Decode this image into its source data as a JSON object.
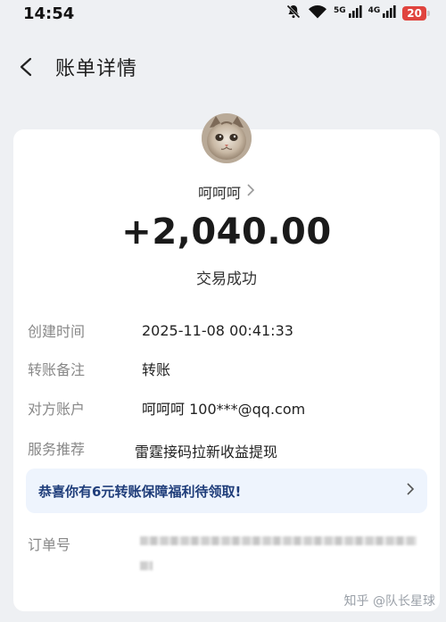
{
  "status_bar": {
    "time": "14:54",
    "signal_5g": "5G",
    "signal_4g": "4G",
    "battery": "20"
  },
  "nav": {
    "title": "账单详情"
  },
  "detail": {
    "payee_name": "呵呵呵",
    "amount": "+2,040.00",
    "status": "交易成功",
    "rows": [
      {
        "label": "创建时间",
        "value": "2025-11-08 00:41:33"
      },
      {
        "label": "转账备注",
        "value": "转账"
      },
      {
        "label": "对方账户",
        "value": "呵呵呵 100***@qq.com"
      },
      {
        "label": "服务推荐",
        "value": "雷霆接码拉新收益提现"
      }
    ],
    "banner_text": "恭喜你有6元转账保障福利待领取!",
    "order_label": "订单号"
  },
  "watermark": "知乎 @队长星球",
  "colors": {
    "background": "#eef0f3",
    "promo_red": "#d4262b",
    "banner_bg": "#eef4fd",
    "battery_red": "#e0443e"
  },
  "icons": [
    "back-arrow-icon",
    "chevron-right-icon",
    "mute-icon",
    "wifi-icon",
    "signal-icon",
    "battery-icon"
  ]
}
